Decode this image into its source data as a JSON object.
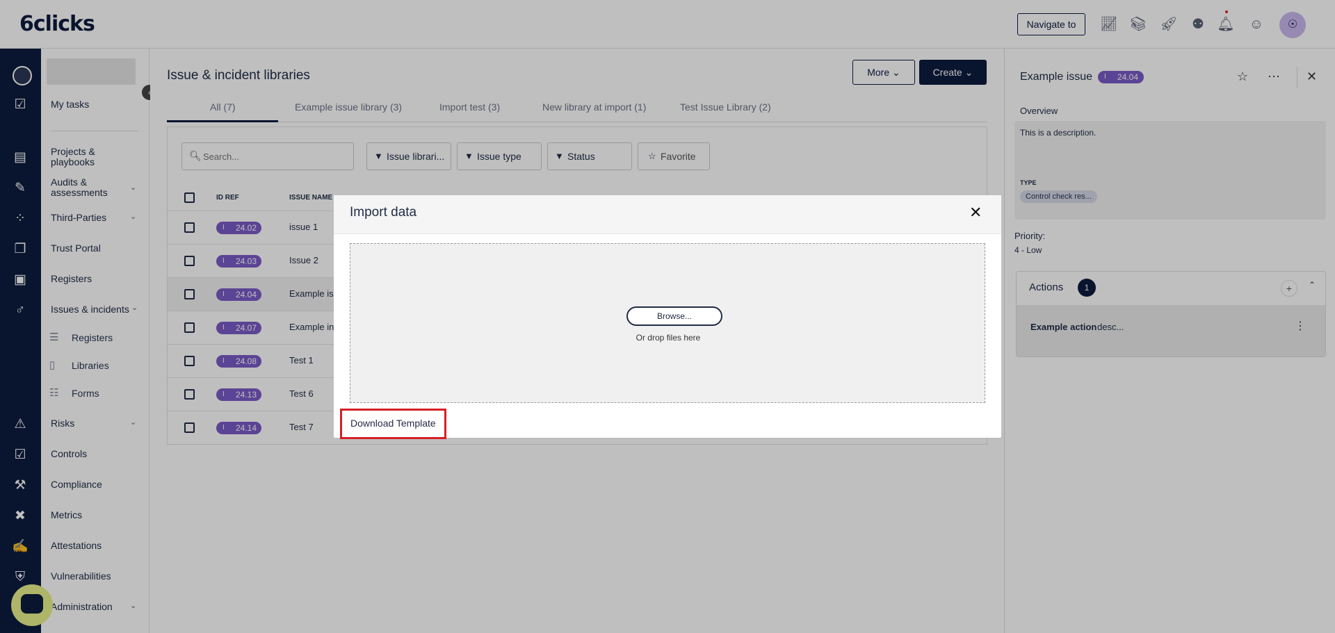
{
  "app": {
    "logo": "6clicks",
    "navigate_label": "Navigate to"
  },
  "sidebar": {
    "my_tasks": "My tasks",
    "items": [
      {
        "label": "Projects &",
        "label2": "playbooks"
      },
      {
        "label": "Audits &",
        "label2": "assessments"
      },
      {
        "label": "Third-Parties"
      },
      {
        "label": "Trust Portal"
      },
      {
        "label": "Registers"
      },
      {
        "label": "Issues & incidents"
      },
      {
        "label": "Risks"
      },
      {
        "label": "Controls"
      },
      {
        "label": "Compliance"
      },
      {
        "label": "Metrics"
      },
      {
        "label": "Attestations"
      },
      {
        "label": "Vulnerabilities"
      },
      {
        "label": "Administration"
      }
    ],
    "sub_items": [
      {
        "label": "Registers",
        "icon": "layers-icon"
      },
      {
        "label": "Libraries",
        "icon": "book-icon"
      },
      {
        "label": "Forms",
        "icon": "clipboard-icon"
      }
    ]
  },
  "main": {
    "title": "Issue & incident libraries",
    "more_label": "More",
    "create_label": "Create",
    "tabs": [
      {
        "label": "All (7)"
      },
      {
        "label": "Example issue library (3)"
      },
      {
        "label": "Import test (3)"
      },
      {
        "label": "New library at import (1)"
      },
      {
        "label": "Test Issue Library (2)"
      }
    ],
    "search_placeholder": "Search...",
    "filters": [
      {
        "label": "Issue librari..."
      },
      {
        "label": "Issue type"
      },
      {
        "label": "Status"
      }
    ],
    "favorite_label": "Favorite",
    "columns": {
      "id_ref": "ID REF",
      "issue_name": "ISSUE NAME"
    },
    "rows": [
      {
        "id": "24.02",
        "name": "issue 1"
      },
      {
        "id": "24.03",
        "name": "Issue 2"
      },
      {
        "id": "24.04",
        "name": "Example iss"
      },
      {
        "id": "24.07",
        "name": "Example in"
      },
      {
        "id": "24.08",
        "name": "Test 1"
      },
      {
        "id": "24.13",
        "name": "Test 6"
      },
      {
        "id": "24.14",
        "name": "Test 7"
      }
    ],
    "badge_prefix": "I"
  },
  "detail": {
    "title": "Example issue",
    "badge_id": "24.04",
    "overview_label": "Overview",
    "description": "This is a description.",
    "type_label": "TYPE",
    "type_value": "Control check res...",
    "priority_label": "Priority:",
    "priority_value": "4 - Low",
    "actions_label": "Actions",
    "actions_count": "1",
    "action_name": "Example action",
    "action_desc": "desc..."
  },
  "modal": {
    "title": "Import data",
    "browse_label": "Browse...",
    "drop_text": "Or drop files here",
    "download_label": "Download Template"
  },
  "colors": {
    "navy": "#0d1b3e",
    "badge_purple": "#7a5bc7",
    "highlight_red": "#d61f26"
  }
}
